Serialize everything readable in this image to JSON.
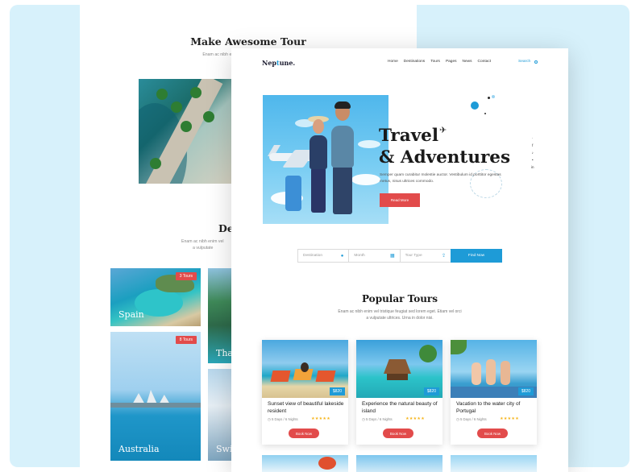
{
  "back_page": {
    "title": "Make Awesome Tour",
    "subtitle_line1": "Enam ac nibh enim vel tristique feugiat sed lorem",
    "subtitle_line2": "a vulputate",
    "dest_title": "De",
    "dest_sub": "Enam ac nibh enim vel",
    "dest_sub2": "a vulputate",
    "cards": [
      {
        "name": "Spain",
        "badge": "3 Tours"
      },
      {
        "name": "Tha",
        "badge": ""
      },
      {
        "name": "Australia",
        "badge": "8 Tours"
      },
      {
        "name": "Swi",
        "badge": ""
      }
    ]
  },
  "front_page": {
    "logo_pre": "Nep",
    "logo_accent": "t",
    "logo_post": "une.",
    "nav": [
      "Home",
      "Destinations",
      "Tours",
      "Pages",
      "News",
      "Contact"
    ],
    "search_label": "Search",
    "hero": {
      "title_line1": "Travel",
      "title_line2": "& Adventures",
      "description": "Semper quam curabitur molestie auctor. Vestibulum id porttitor egestas metus, nisus ultrices commodo.",
      "button": "Read More",
      "social": [
        "f",
        "♪",
        "•",
        "in"
      ]
    },
    "searchbar": {
      "destination": "Destination",
      "month": "Month",
      "tour_type": "Tour Type",
      "button": "Find Now"
    },
    "popular": {
      "title": "Popular Tours",
      "subtitle_line1": "Enam ac nibh enim vel tristique feugiat sed lorem eget. Etiam vel orci",
      "subtitle_line2": "a vulputate ultrices. Urna in dolor nisi."
    },
    "tours": [
      {
        "title": "Sunset view of beautiful lakeside resident",
        "meta": "5 Days / 6 Nights",
        "price": "$820",
        "stars": "★★★★★",
        "button": "Book Now"
      },
      {
        "title": "Experience the natural beauty of island",
        "meta": "5 Days / 6 Nights",
        "price": "$820",
        "stars": "★★★★★",
        "button": "Book Now"
      },
      {
        "title": "Vacation to the water city of Portugal",
        "meta": "5 Days / 6 Nights",
        "price": "$820",
        "stars": "★★★★★",
        "button": "Book Now"
      }
    ]
  },
  "colors": {
    "accent": "#1e9bd7",
    "cta": "#e24b4b",
    "backdrop": "#d7f1fb"
  }
}
